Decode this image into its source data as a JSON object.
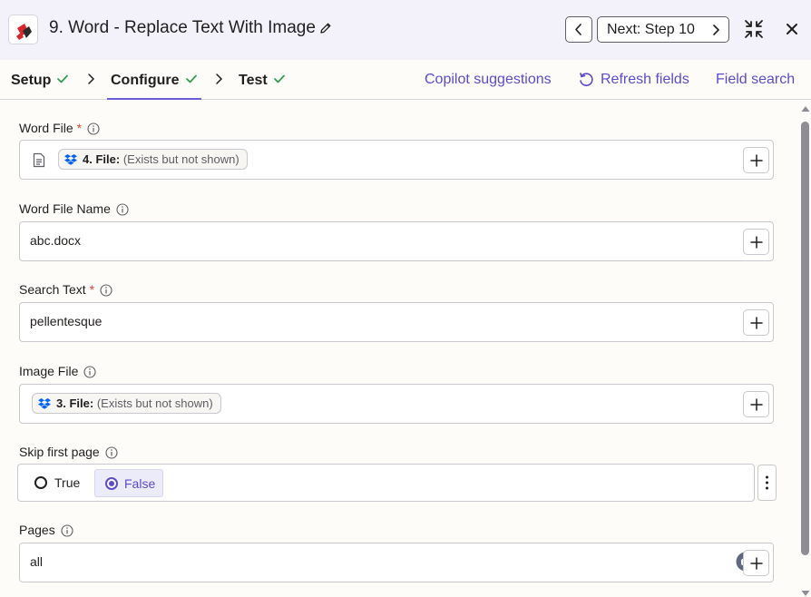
{
  "header": {
    "title": "9. Word - Replace Text With Image",
    "next_label": "Next: Step 10"
  },
  "tabs": [
    {
      "label": "Setup",
      "complete": true
    },
    {
      "label": "Configure",
      "complete": true,
      "active": true
    },
    {
      "label": "Test",
      "complete": true
    }
  ],
  "links": {
    "copilot": "Copilot suggestions",
    "refresh": "Refresh fields",
    "search": "Field search"
  },
  "fields": {
    "word_file": {
      "label": "Word File",
      "required_mark": "*",
      "pill_label": "4. File:",
      "pill_note": "(Exists but not shown)"
    },
    "word_file_name": {
      "label": "Word File Name",
      "value": "abc.docx"
    },
    "search_text": {
      "label": "Search Text",
      "required_mark": "*",
      "value": "pellentesque"
    },
    "image_file": {
      "label": "Image File",
      "pill_label": "3. File:",
      "pill_note": "(Exists but not shown)"
    },
    "skip_first_page": {
      "label": "Skip first page",
      "options": [
        "True",
        "False"
      ],
      "selected": "False"
    },
    "pages": {
      "label": "Pages",
      "value": "all"
    }
  },
  "colors": {
    "accent": "#5b4ccc",
    "success": "#2e9e4f",
    "required": "#e0442f",
    "header_bg": "#f3f2fb",
    "dropbox_blue": "#0061fe"
  },
  "icons": [
    "app-logo-icon",
    "pencil-icon",
    "chevron-left-icon",
    "chevron-right-icon",
    "collapse-icon",
    "close-icon",
    "check-icon",
    "refresh-icon",
    "info-icon",
    "document-icon",
    "dropbox-icon",
    "plus-icon",
    "ai-assistant-icon",
    "kebab-icon"
  ]
}
